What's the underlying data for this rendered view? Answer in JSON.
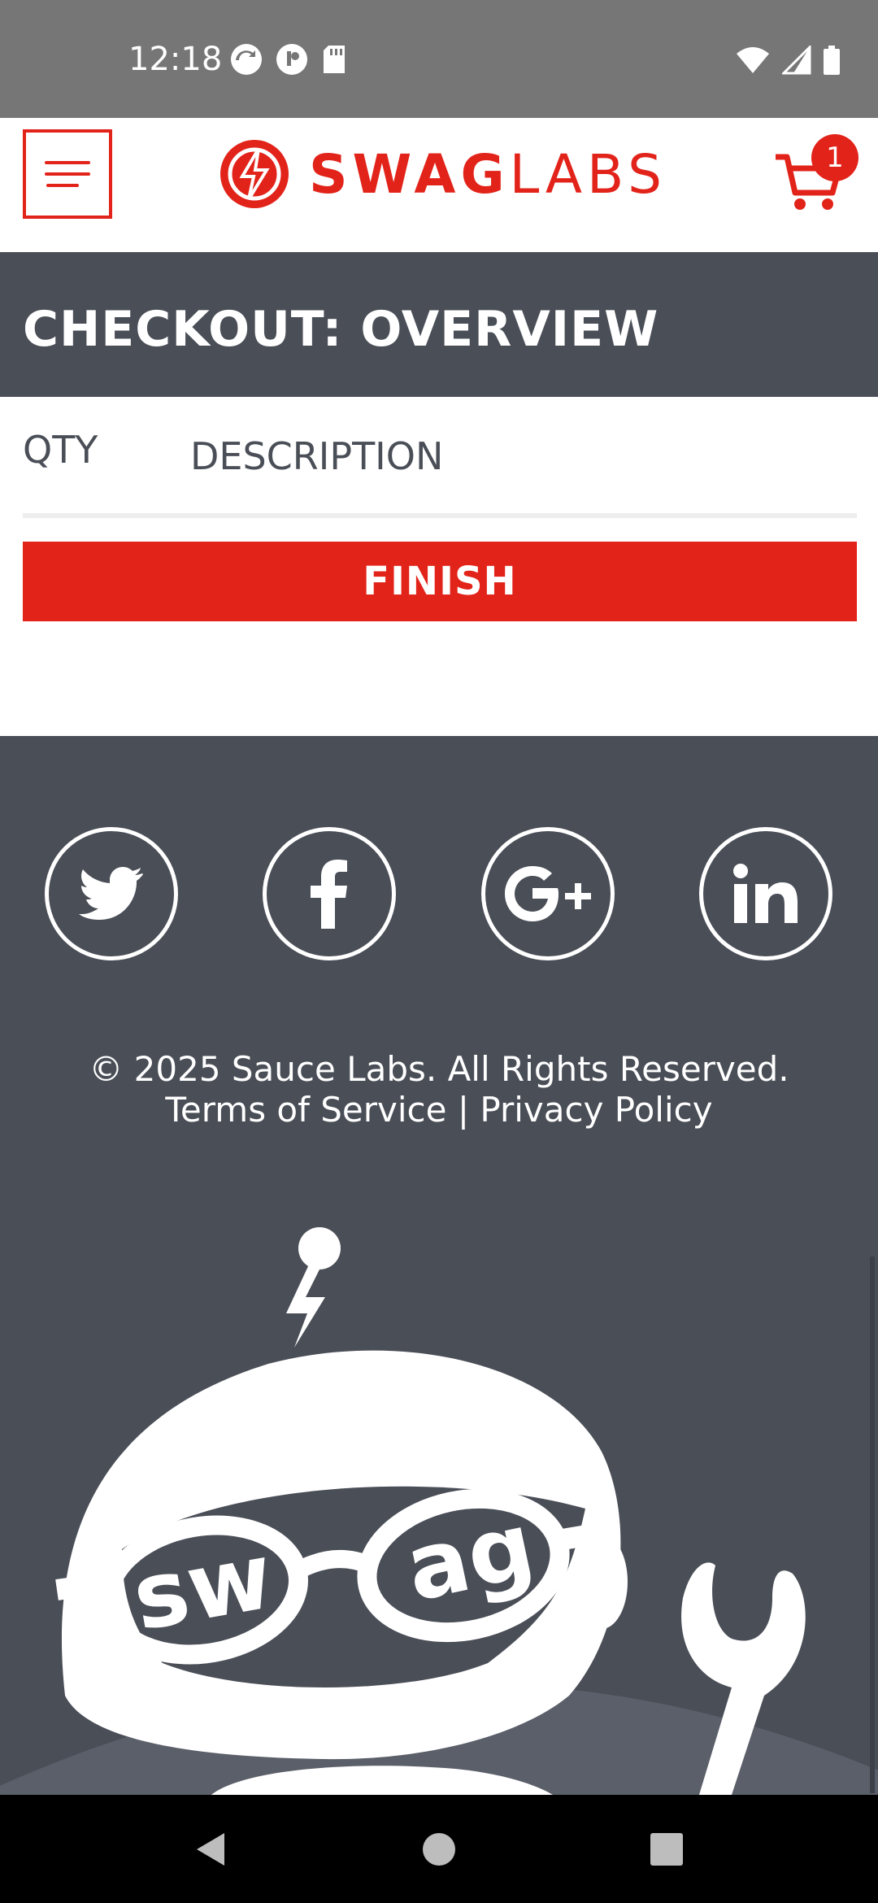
{
  "status_bar": {
    "time": "12:18"
  },
  "header": {
    "brand_bold": "SWAG",
    "brand_light": "LABS",
    "cart_count": "1"
  },
  "page": {
    "title": "CHECKOUT: OVERVIEW"
  },
  "columns": {
    "qty": "QTY",
    "description": "DESCRIPTION"
  },
  "actions": {
    "finish_label": "FINISH"
  },
  "footer": {
    "social": [
      "twitter-icon",
      "facebook-icon",
      "google-plus-icon",
      "linkedin-icon"
    ],
    "copyright": "© 2025 Sauce Labs. All Rights Reserved.",
    "terms": "Terms of Service",
    "separator": "|",
    "privacy": "Privacy Policy",
    "mascot_text_left": "sw",
    "mascot_text_right": "ag"
  },
  "colors": {
    "brand_red": "#e2231a",
    "dark_gray": "#4a4e57",
    "status_gray": "#767676"
  }
}
